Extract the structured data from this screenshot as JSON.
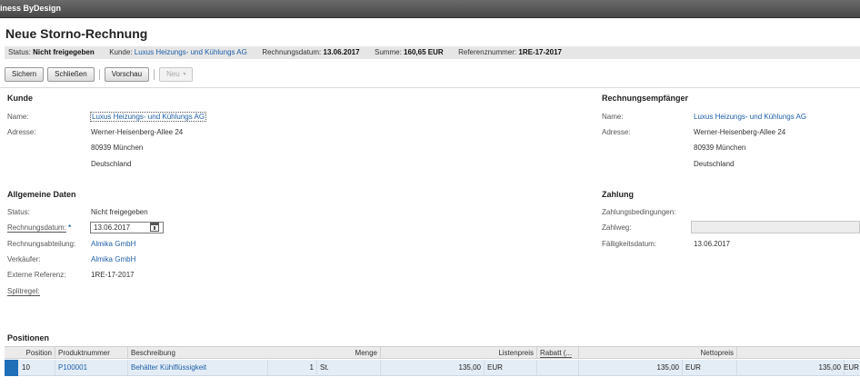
{
  "shell": {
    "title": "iness ByDesign"
  },
  "page": {
    "title": "Neue Storno-Rechnung"
  },
  "status_strip": {
    "status_label": "Status:",
    "status_value": "Nicht freigegeben",
    "kunde_label": "Kunde:",
    "kunde_value": "Luxus Heizungs- und Kühlungs AG",
    "rechnungsdatum_label": "Rechnungsdatum:",
    "rechnungsdatum_value": "13.06.2017",
    "summe_label": "Summe:",
    "summe_value": "160,65",
    "summe_currency": "EUR",
    "referenz_label": "Referenznummer:",
    "referenz_value": "1RE-17-2017"
  },
  "toolbar": {
    "sichern": "Sichern",
    "schliessen": "Schließen",
    "vorschau": "Vorschau",
    "neu": "Neu"
  },
  "kunde": {
    "heading": "Kunde",
    "name_label": "Name:",
    "name_value": "Luxus Heizungs- und Kühlungs AG",
    "adresse_label": "Adresse:",
    "adresse_lines": [
      "Werner-Heisenberg-Allee 24",
      "80939 München",
      "Deutschland"
    ]
  },
  "rechnungsempfaenger": {
    "heading": "Rechnungsempfänger",
    "name_label": "Name:",
    "name_value": "Luxus Heizungs- und Kühlungs AG",
    "adresse_label": "Adresse:",
    "adresse_lines": [
      "Werner-Heisenberg-Allee 24",
      "80939 München",
      "Deutschland"
    ]
  },
  "allgemeine_daten": {
    "heading": "Allgemeine Daten",
    "status_label": "Status:",
    "status_value": "Nicht freigegeben",
    "rechnungsdatum_label": "Rechnungsdatum:",
    "rechnungsdatum_required": "*",
    "rechnungsdatum_value": "13.06.2017",
    "rechnungsabteilung_label": "Rechnungsabteilung:",
    "rechnungsabteilung_value": "Almika GmbH",
    "verkaeufer_label": "Verkäufer:",
    "verkaeufer_value": "Almika GmbH",
    "externe_referenz_label": "Externe Referenz:",
    "externe_referenz_value": "1RE-17-2017",
    "splitregel_label": "Splitregel:"
  },
  "zahlung": {
    "heading": "Zahlung",
    "zahlungsbedingungen_label": "Zahlungsbedingungen:",
    "zahlweg_label": "Zahlweg:",
    "zahlweg_value": "",
    "faelligkeitsdatum_label": "Fälligkeitsdatum:",
    "faelligkeitsdatum_value": "13.06.2017"
  },
  "positionen": {
    "heading": "Positionen",
    "columns": [
      "Position",
      "Produktnummer",
      "Beschreibung",
      "Menge",
      "Listenpreis",
      "Rabatt (...",
      "Nettopreis"
    ],
    "rows": [
      {
        "position": "10",
        "produktnummer": "P100001",
        "beschreibung": "Behälter Kühlflüssigkeit",
        "menge": "1",
        "menge_unit": "St.",
        "listenpreis": "135,00",
        "listenpreis_currency": "EUR",
        "rabatt": "",
        "nettopreis": "135,00",
        "nettopreis_currency": "EUR",
        "gesamt": "135,00",
        "gesamt_currency": "EUR"
      }
    ]
  }
}
